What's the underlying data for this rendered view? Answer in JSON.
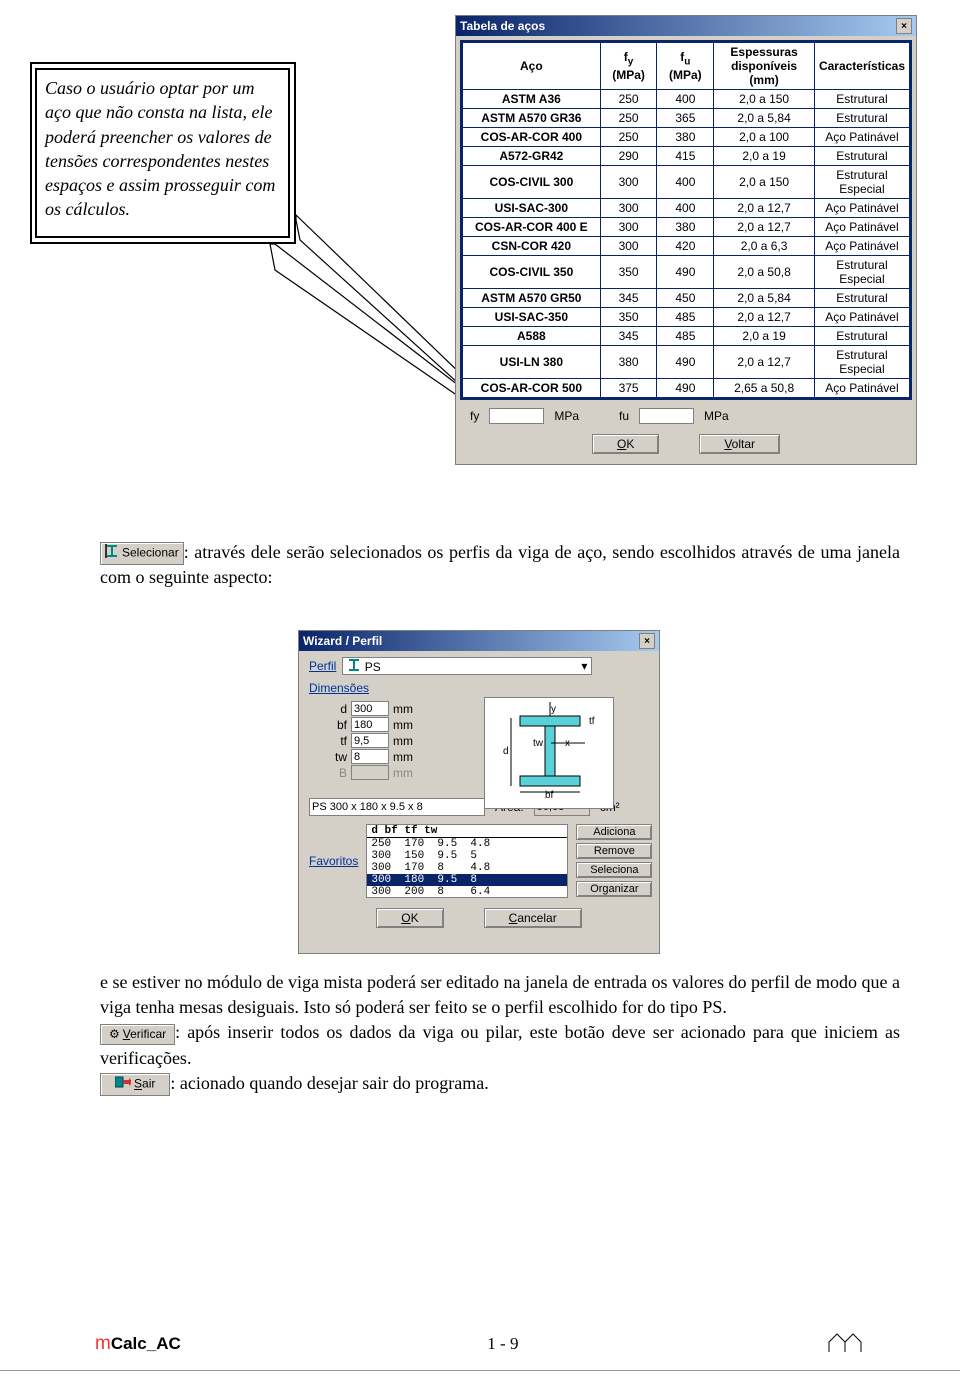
{
  "callout": {
    "text": "Caso o usuário optar por um aço que não consta na lista, ele poderá preencher os valores de tensões correspondentes nestes espaços e assim prosseguir com os cálculos."
  },
  "steel_window": {
    "title": "Tabela de  aços",
    "headers": {
      "aco": "Aço",
      "fy": "f",
      "fy_sub": "y",
      "fy_unit": "(MPa)",
      "fu": "f",
      "fu_sub": "u",
      "fu_unit": "(MPa)",
      "esp": "Espessuras disponíveis (mm)",
      "car": "Características"
    },
    "rows": [
      {
        "aco": "ASTM A36",
        "fy": "250",
        "fu": "400",
        "esp": "2,0 a 150",
        "car": "Estrutural"
      },
      {
        "aco": "ASTM A570 GR36",
        "fy": "250",
        "fu": "365",
        "esp": "2,0 a 5,84",
        "car": "Estrutural"
      },
      {
        "aco": "COS-AR-COR 400",
        "fy": "250",
        "fu": "380",
        "esp": "2,0 a 100",
        "car": "Aço Patinável"
      },
      {
        "aco": "A572-GR42",
        "fy": "290",
        "fu": "415",
        "esp": "2,0 a 19",
        "car": "Estrutural"
      },
      {
        "aco": "COS-CIVIL 300",
        "fy": "300",
        "fu": "400",
        "esp": "2,0 a 150",
        "car": "Estrutural Especial"
      },
      {
        "aco": "USI-SAC-300",
        "fy": "300",
        "fu": "400",
        "esp": "2,0 a 12,7",
        "car": "Aço Patinável"
      },
      {
        "aco": "COS-AR-COR 400 E",
        "fy": "300",
        "fu": "380",
        "esp": "2,0 a 12,7",
        "car": "Aço Patinável"
      },
      {
        "aco": "CSN-COR 420",
        "fy": "300",
        "fu": "420",
        "esp": "2,0 a 6,3",
        "car": "Aço Patinável"
      },
      {
        "aco": "COS-CIVIL 350",
        "fy": "350",
        "fu": "490",
        "esp": "2,0 a 50,8",
        "car": "Estrutural Especial"
      },
      {
        "aco": "ASTM A570 GR50",
        "fy": "345",
        "fu": "450",
        "esp": "2,0 a 5,84",
        "car": "Estrutural"
      },
      {
        "aco": "USI-SAC-350",
        "fy": "350",
        "fu": "485",
        "esp": "2,0 a 12,7",
        "car": "Aço Patinável"
      },
      {
        "aco": "A588",
        "fy": "345",
        "fu": "485",
        "esp": "2,0 a 19",
        "car": "Estrutural"
      },
      {
        "aco": "USI-LN 380",
        "fy": "380",
        "fu": "490",
        "esp": "2,0 a 12,7",
        "car": "Estrutural Especial"
      },
      {
        "aco": "COS-AR-COR 500",
        "fy": "375",
        "fu": "490",
        "esp": "2,65 a 50,8",
        "car": "Aço Patinável"
      }
    ],
    "inputs": {
      "fy_label": "fy",
      "mpa": "MPa",
      "fu_label": "fu"
    },
    "buttons": {
      "ok": "OK",
      "voltar": "Voltar"
    }
  },
  "para1_btn": "Selecionar",
  "para1": ": através dele serão selecionados os perfis da viga de aço, sendo escolhidos através de uma janela com o seguinte aspecto:",
  "wizard": {
    "title": "Wizard / Perfil",
    "perfil_label": "Perfil",
    "perfil_value": "PS",
    "dimensoes": "Dimensões",
    "dims": {
      "d_label": "d",
      "d": "300",
      "bf_label": "bf",
      "bf": "180",
      "tf_label": "tf",
      "tf": "9,5",
      "tw_label": "tw",
      "tw": "8",
      "B_label": "B",
      "B": ""
    },
    "mm": "mm",
    "name_value": "PS 300 x 180 x 9.5 x 8",
    "area_label": "Área:",
    "area_value": "56,68",
    "area_unit": "cm²",
    "favoritos": "Favoritos",
    "listhdr": "d    bf   tf   tw",
    "listrows": [
      "250  170  9.5  4.8",
      "300  150  9.5  5",
      "300  170  8    4.8",
      "300  180  9.5  8",
      "300  200  8    6.4"
    ],
    "sidebtns": {
      "add": "Adiciona",
      "rem": "Remove",
      "sel": "Seleciona",
      "org": "Organizar"
    },
    "ok": "OK",
    "cancel": "Cancelar"
  },
  "para2": "e se estiver no módulo de viga mista poderá ser editado na janela de entrada os valores do perfil de modo que a viga tenha mesas desiguais. Isto só poderá ser feito se o perfil escolhido for do tipo PS.",
  "verificar_btn": "Verificar",
  "para3": ": após inserir todos os dados da viga ou pilar, este botão deve ser acionado para que iniciem as verificações.",
  "sair_btn": "Sair",
  "para4": ": acionado quando desejar sair do programa.",
  "footer": {
    "logo_pre": "m",
    "logo": "Calc_AC",
    "page": "1 - 9"
  }
}
